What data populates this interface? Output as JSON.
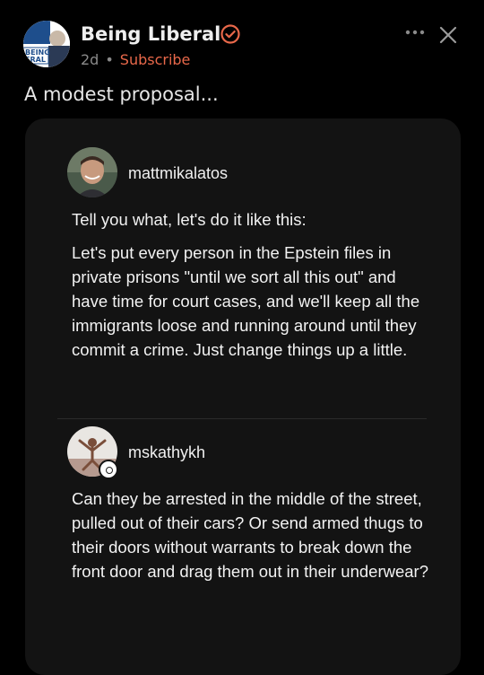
{
  "post": {
    "page_name": "Being Liberal",
    "time_ago": "2d",
    "separator": "•",
    "subscribe_label": "Subscribe",
    "caption": "A modest proposal...",
    "avatar_text": "BEING LIBERAL"
  },
  "comments": [
    {
      "username": "mattmikalatos",
      "lines": [
        "Tell you what, let's do it like this:",
        "Let's put every person in the Epstein files in private prisons \"until we sort all this out\" and have time for court cases, and we'll keep all the immigrants loose and running around until they commit a crime. Just change things up a little."
      ]
    },
    {
      "username": "mskathykh",
      "lines": [
        "Can they be arrested in the middle of the street, pulled out of their cars? Or send armed thugs to their doors without warrants to break down the front door and drag them out in their underwear?"
      ]
    }
  ],
  "colors": {
    "background": "#000000",
    "card": "#131313",
    "accent": "#e8684a",
    "muted": "#8a8a8a"
  },
  "icons": [
    "verified-icon",
    "more-icon",
    "close-icon"
  ]
}
